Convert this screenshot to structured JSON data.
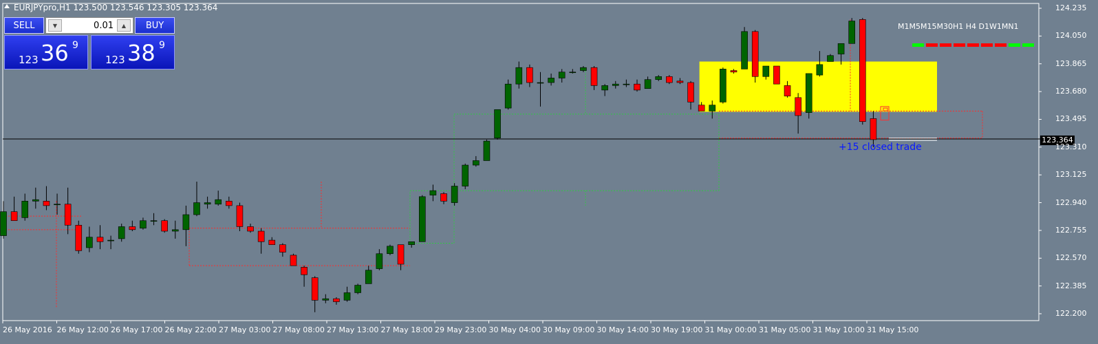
{
  "header": {
    "title": "EURJPYpro,H1  123.500 123.546 123.305 123.364"
  },
  "trade_panel": {
    "sell_label": "SELL",
    "buy_label": "BUY",
    "lot_value": "0.01",
    "sell_quote": {
      "small": "123",
      "big": "36",
      "sup": "9"
    },
    "buy_quote": {
      "small": "123",
      "big": "38",
      "sup": "9"
    }
  },
  "timeframes": "M1M5M15M30H1 H4 D1W1MN1",
  "trade_annotation": "+15 closed trade",
  "colors": {
    "background": "#708090",
    "bull": "#006400",
    "bear": "#ff0000",
    "zone": "#ffff00",
    "current_line": "#000000"
  },
  "chart_data": {
    "type": "candlestick",
    "symbol": "EURJPYpro",
    "timeframe": "H1",
    "ohlc": {
      "open": 123.5,
      "high": 123.546,
      "low": 123.305,
      "close": 123.364
    },
    "current_price": "123.364",
    "ylim": [
      122.15,
      124.28
    ],
    "y_ticks": [
      "124.235",
      "124.050",
      "123.865",
      "123.680",
      "123.495",
      "123.310",
      "123.125",
      "122.940",
      "122.755",
      "122.570",
      "122.385",
      "122.200"
    ],
    "x_ticks": [
      "26 May 2016",
      "26 May 12:00",
      "26 May 17:00",
      "26 May 22:00",
      "27 May 03:00",
      "27 May 08:00",
      "27 May 13:00",
      "27 May 18:00",
      "29 May 23:00",
      "30 May 04:00",
      "30 May 09:00",
      "30 May 14:00",
      "30 May 19:00",
      "31 May 00:00",
      "31 May 05:00",
      "31 May 10:00",
      "31 May 15:00"
    ],
    "candles": [
      {
        "o": 122.72,
        "h": 122.95,
        "l": 122.7,
        "c": 122.88
      },
      {
        "o": 122.88,
        "h": 122.98,
        "l": 122.83,
        "c": 122.82
      },
      {
        "o": 122.84,
        "h": 123.0,
        "l": 122.82,
        "c": 122.95
      },
      {
        "o": 122.95,
        "h": 123.04,
        "l": 122.9,
        "c": 122.96
      },
      {
        "o": 122.95,
        "h": 123.05,
        "l": 122.89,
        "c": 122.92
      },
      {
        "o": 122.93,
        "h": 123.0,
        "l": 122.86,
        "c": 122.93
      },
      {
        "o": 122.93,
        "h": 123.04,
        "l": 122.73,
        "c": 122.79
      },
      {
        "o": 122.79,
        "h": 122.82,
        "l": 122.6,
        "c": 122.62
      },
      {
        "o": 122.64,
        "h": 122.78,
        "l": 122.61,
        "c": 122.71
      },
      {
        "o": 122.71,
        "h": 122.79,
        "l": 122.63,
        "c": 122.68
      },
      {
        "o": 122.69,
        "h": 122.72,
        "l": 122.63,
        "c": 122.69
      },
      {
        "o": 122.7,
        "h": 122.8,
        "l": 122.68,
        "c": 122.78
      },
      {
        "o": 122.78,
        "h": 122.82,
        "l": 122.75,
        "c": 122.76
      },
      {
        "o": 122.77,
        "h": 122.84,
        "l": 122.76,
        "c": 122.82
      },
      {
        "o": 122.82,
        "h": 122.87,
        "l": 122.79,
        "c": 122.82
      },
      {
        "o": 122.82,
        "h": 122.83,
        "l": 122.74,
        "c": 122.75
      },
      {
        "o": 122.75,
        "h": 122.82,
        "l": 122.7,
        "c": 122.76
      },
      {
        "o": 122.76,
        "h": 122.92,
        "l": 122.65,
        "c": 122.86
      },
      {
        "o": 122.86,
        "h": 123.08,
        "l": 122.85,
        "c": 122.94
      },
      {
        "o": 122.93,
        "h": 122.98,
        "l": 122.9,
        "c": 122.94
      },
      {
        "o": 122.93,
        "h": 123.02,
        "l": 122.92,
        "c": 122.96
      },
      {
        "o": 122.95,
        "h": 122.98,
        "l": 122.9,
        "c": 122.92
      },
      {
        "o": 122.92,
        "h": 122.94,
        "l": 122.75,
        "c": 122.78
      },
      {
        "o": 122.78,
        "h": 122.8,
        "l": 122.74,
        "c": 122.75
      },
      {
        "o": 122.75,
        "h": 122.77,
        "l": 122.6,
        "c": 122.68
      },
      {
        "o": 122.69,
        "h": 122.71,
        "l": 122.66,
        "c": 122.66
      },
      {
        "o": 122.66,
        "h": 122.67,
        "l": 122.58,
        "c": 122.61
      },
      {
        "o": 122.59,
        "h": 122.6,
        "l": 122.52,
        "c": 122.52
      },
      {
        "o": 122.51,
        "h": 122.52,
        "l": 122.38,
        "c": 122.46
      },
      {
        "o": 122.44,
        "h": 122.45,
        "l": 122.21,
        "c": 122.29
      },
      {
        "o": 122.29,
        "h": 122.33,
        "l": 122.27,
        "c": 122.3
      },
      {
        "o": 122.3,
        "h": 122.31,
        "l": 122.26,
        "c": 122.28
      },
      {
        "o": 122.29,
        "h": 122.38,
        "l": 122.28,
        "c": 122.34
      },
      {
        "o": 122.34,
        "h": 122.4,
        "l": 122.33,
        "c": 122.39
      },
      {
        "o": 122.4,
        "h": 122.52,
        "l": 122.4,
        "c": 122.49
      },
      {
        "o": 122.5,
        "h": 122.63,
        "l": 122.49,
        "c": 122.6
      },
      {
        "o": 122.6,
        "h": 122.66,
        "l": 122.59,
        "c": 122.65
      },
      {
        "o": 122.66,
        "h": 122.66,
        "l": 122.49,
        "c": 122.53
      },
      {
        "o": 122.66,
        "h": 122.68,
        "l": 122.64,
        "c": 122.68
      },
      {
        "o": 122.68,
        "h": 122.99,
        "l": 122.68,
        "c": 122.98
      },
      {
        "o": 122.99,
        "h": 123.06,
        "l": 122.95,
        "c": 123.02
      },
      {
        "o": 123.0,
        "h": 123.01,
        "l": 122.93,
        "c": 122.95
      },
      {
        "o": 122.94,
        "h": 123.07,
        "l": 122.92,
        "c": 123.05
      },
      {
        "o": 123.05,
        "h": 123.2,
        "l": 123.03,
        "c": 123.19
      },
      {
        "o": 123.19,
        "h": 123.25,
        "l": 123.18,
        "c": 123.22
      },
      {
        "o": 123.22,
        "h": 123.36,
        "l": 123.22,
        "c": 123.35
      },
      {
        "o": 123.37,
        "h": 123.56,
        "l": 123.36,
        "c": 123.56
      },
      {
        "o": 123.57,
        "h": 123.76,
        "l": 123.56,
        "c": 123.73
      },
      {
        "o": 123.73,
        "h": 123.88,
        "l": 123.7,
        "c": 123.84
      },
      {
        "o": 123.84,
        "h": 123.86,
        "l": 123.71,
        "c": 123.74
      },
      {
        "o": 123.74,
        "h": 123.81,
        "l": 123.58,
        "c": 123.74
      },
      {
        "o": 123.74,
        "h": 123.8,
        "l": 123.72,
        "c": 123.77
      },
      {
        "o": 123.77,
        "h": 123.83,
        "l": 123.74,
        "c": 123.81
      },
      {
        "o": 123.81,
        "h": 123.83,
        "l": 123.8,
        "c": 123.81
      },
      {
        "o": 123.82,
        "h": 123.85,
        "l": 123.81,
        "c": 123.84
      },
      {
        "o": 123.84,
        "h": 123.85,
        "l": 123.69,
        "c": 123.72
      },
      {
        "o": 123.69,
        "h": 123.73,
        "l": 123.65,
        "c": 123.72
      },
      {
        "o": 123.72,
        "h": 123.75,
        "l": 123.7,
        "c": 123.73
      },
      {
        "o": 123.73,
        "h": 123.76,
        "l": 123.71,
        "c": 123.73
      },
      {
        "o": 123.73,
        "h": 123.76,
        "l": 123.68,
        "c": 123.69
      },
      {
        "o": 123.7,
        "h": 123.78,
        "l": 123.7,
        "c": 123.76
      },
      {
        "o": 123.76,
        "h": 123.79,
        "l": 123.75,
        "c": 123.78
      },
      {
        "o": 123.78,
        "h": 123.79,
        "l": 123.73,
        "c": 123.74
      },
      {
        "o": 123.75,
        "h": 123.77,
        "l": 123.73,
        "c": 123.74
      },
      {
        "o": 123.74,
        "h": 123.75,
        "l": 123.56,
        "c": 123.61
      },
      {
        "o": 123.59,
        "h": 123.61,
        "l": 123.55,
        "c": 123.55
      },
      {
        "o": 123.55,
        "h": 123.62,
        "l": 123.5,
        "c": 123.59
      },
      {
        "o": 123.61,
        "h": 123.84,
        "l": 123.6,
        "c": 123.83
      },
      {
        "o": 123.82,
        "h": 123.83,
        "l": 123.8,
        "c": 123.81
      },
      {
        "o": 123.83,
        "h": 124.11,
        "l": 123.83,
        "c": 124.08
      },
      {
        "o": 124.08,
        "h": 124.09,
        "l": 123.74,
        "c": 123.78
      },
      {
        "o": 123.78,
        "h": 123.85,
        "l": 123.76,
        "c": 123.85
      },
      {
        "o": 123.85,
        "h": 123.85,
        "l": 123.75,
        "c": 123.73
      },
      {
        "o": 123.72,
        "h": 123.75,
        "l": 123.64,
        "c": 123.65
      },
      {
        "o": 123.64,
        "h": 123.67,
        "l": 123.4,
        "c": 123.52
      },
      {
        "o": 123.54,
        "h": 123.8,
        "l": 123.5,
        "c": 123.8
      },
      {
        "o": 123.79,
        "h": 123.95,
        "l": 123.78,
        "c": 123.86
      },
      {
        "o": 123.88,
        "h": 123.93,
        "l": 123.88,
        "c": 123.92
      },
      {
        "o": 123.93,
        "h": 124.0,
        "l": 123.86,
        "c": 124.0
      },
      {
        "o": 124.0,
        "h": 124.17,
        "l": 124.0,
        "c": 124.15
      },
      {
        "o": 124.16,
        "h": 124.17,
        "l": 123.46,
        "c": 123.48
      },
      {
        "o": 123.5,
        "h": 123.55,
        "l": 123.31,
        "c": 123.36
      }
    ]
  }
}
